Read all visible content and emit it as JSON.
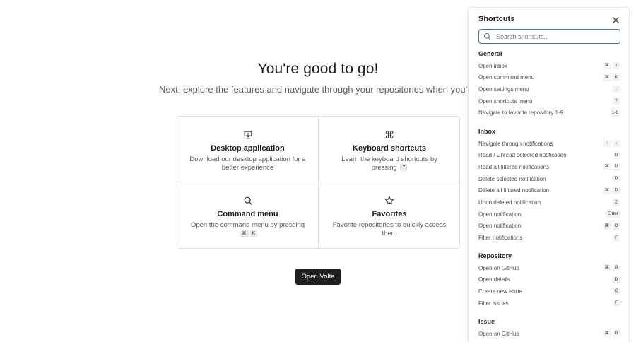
{
  "main": {
    "title": "You're good to go!",
    "subtitle": "Next, explore the features and navigate through your repositories when you're in the ap",
    "cards": [
      {
        "title": "Desktop application",
        "desc": "Download our desktop application for a better experience",
        "icon": "download-icon"
      },
      {
        "title": "Keyboard shortcuts",
        "desc": "Learn the keyboard shortcuts by pressing",
        "key": "?",
        "icon": "command-key-icon"
      },
      {
        "title": "Command menu",
        "desc": "Open the command menu by pressing",
        "keys": [
          "⌘",
          "K"
        ],
        "icon": "search-icon"
      },
      {
        "title": "Favorites",
        "desc": "Favorite repositories to quickly access them",
        "icon": "star-icon"
      }
    ],
    "open_button": "Open Volta"
  },
  "shortcuts": {
    "title": "Shortcuts",
    "search_placeholder": "Search shortcuts...",
    "sections": [
      {
        "title": "General",
        "items": [
          {
            "label": "Open inbox",
            "keys": [
              "⌘",
              "I"
            ]
          },
          {
            "label": "Open command menu",
            "keys": [
              "⌘",
              "K"
            ]
          },
          {
            "label": "Open settings menu",
            "keys": [
              ","
            ]
          },
          {
            "label": "Open shortcuts menu",
            "keys": [
              "?"
            ]
          },
          {
            "label": "Navigate to favorite repository 1-9",
            "keys": [
              "1-9"
            ]
          }
        ]
      },
      {
        "title": "Inbox",
        "items": [
          {
            "label": "Navigate through notifications",
            "keys": [
              "↑",
              "↓"
            ]
          },
          {
            "label": "Read / Unread selected notification",
            "keys": [
              "U"
            ]
          },
          {
            "label": "Read all filtered notifications",
            "keys": [
              "⌘",
              "U"
            ]
          },
          {
            "label": "Delete selected notification",
            "keys": [
              "D"
            ]
          },
          {
            "label": "Delete all filtered notification",
            "keys": [
              "⌘",
              "D"
            ]
          },
          {
            "label": "Undo deleted notification",
            "keys": [
              "Z"
            ]
          },
          {
            "label": "Open notification",
            "keys": [
              "Enter"
            ]
          },
          {
            "label": "Open notification",
            "keys": [
              "⌘",
              "O"
            ]
          },
          {
            "label": "Filter notifications",
            "keys": [
              "F"
            ]
          }
        ]
      },
      {
        "title": "Repository",
        "items": [
          {
            "label": "Open on GitHub",
            "keys": [
              "⌘",
              "G"
            ]
          },
          {
            "label": "Open details",
            "keys": [
              "D"
            ]
          },
          {
            "label": "Create new issue",
            "keys": [
              "C"
            ]
          },
          {
            "label": "Filter issues",
            "keys": [
              "F"
            ]
          }
        ]
      },
      {
        "title": "Issue",
        "items": [
          {
            "label": "Open on GitHub",
            "keys": [
              "⌘",
              "G"
            ]
          }
        ]
      }
    ]
  }
}
